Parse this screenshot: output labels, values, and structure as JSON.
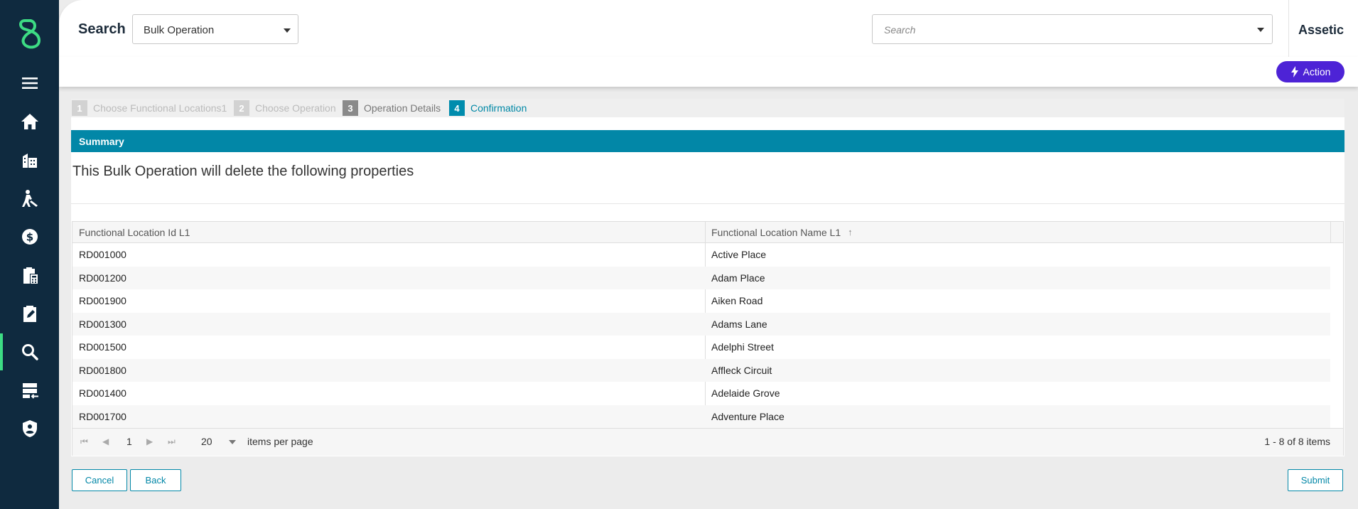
{
  "sidebar": {
    "logo": "assetic-logo",
    "items": [
      {
        "icon": "menu-icon"
      },
      {
        "icon": "home-icon"
      },
      {
        "icon": "buildings-icon"
      },
      {
        "icon": "worker-icon"
      },
      {
        "icon": "finance-icon"
      },
      {
        "icon": "clipboard-calculator-icon"
      },
      {
        "icon": "edit-clipboard-icon"
      },
      {
        "icon": "search-icon",
        "active": true
      },
      {
        "icon": "server-import-icon"
      },
      {
        "icon": "shield-user-icon"
      }
    ],
    "accent_color": "#3ddc84"
  },
  "header": {
    "title": "Search",
    "dropdown_value": "Bulk Operation",
    "search_placeholder": "Search",
    "brand": "Assetic"
  },
  "actionbar": {
    "action_label": "Action"
  },
  "wizard": {
    "steps": [
      {
        "num": "1",
        "label": "Choose Functional Locations1"
      },
      {
        "num": "2",
        "label": "Choose Operation"
      },
      {
        "num": "3",
        "label": "Operation Details"
      },
      {
        "num": "4",
        "label": "Confirmation"
      }
    ]
  },
  "summary": {
    "header": "Summary",
    "description": "This Bulk Operation will delete the following properties"
  },
  "grid": {
    "columns": [
      "Functional Location Id L1",
      "Functional Location Name L1"
    ],
    "sort_indicator": "↑",
    "rows": [
      [
        "RD001000",
        "Active Place"
      ],
      [
        "RD001200",
        "Adam Place"
      ],
      [
        "RD001900",
        "Aiken Road"
      ],
      [
        "RD001300",
        "Adams Lane"
      ],
      [
        "RD001500",
        "Adelphi Street"
      ],
      [
        "RD001800",
        "Affleck Circuit"
      ],
      [
        "RD001400",
        "Adelaide Grove"
      ],
      [
        "RD001700",
        "Adventure Place"
      ]
    ],
    "pager": {
      "page": "1",
      "page_size": "20",
      "items_per_page_label": "items per page",
      "info": "1 - 8 of 8 items"
    }
  },
  "buttons": {
    "cancel": "Cancel",
    "back": "Back",
    "submit": "Submit"
  },
  "colors": {
    "sidebar_bg": "#0f2a3f",
    "primary": "#0287a7",
    "action": "#4d23d6"
  }
}
